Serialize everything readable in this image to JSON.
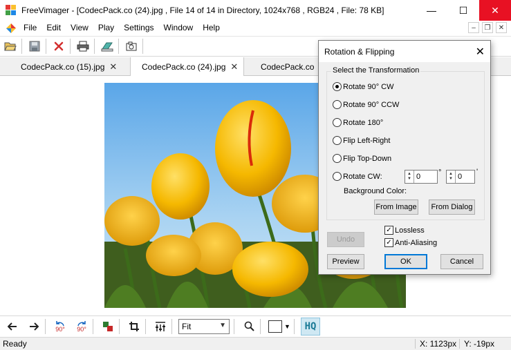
{
  "window": {
    "title": "FreeVimager - [CodecPack.co  (24).jpg , File 14 of 14 in Directory, 1024x768 , RGB24 , File: 78 KB]",
    "controls": {
      "minimize": "—",
      "maximize": "☐",
      "close": "✕"
    }
  },
  "menu": {
    "items": [
      "File",
      "Edit",
      "View",
      "Play",
      "Settings",
      "Window",
      "Help"
    ],
    "mdi": {
      "minimize": "–",
      "restore": "❐",
      "close": "✕"
    }
  },
  "toolbar": {
    "icons": [
      "open-folder-icon",
      "save-icon",
      "delete-icon",
      "print-icon",
      "scan-icon",
      "capture-icon"
    ]
  },
  "tabs": [
    {
      "label": "CodecPack.co  (15).jpg",
      "active": false
    },
    {
      "label": "CodecPack.co  (24).jpg",
      "active": true
    },
    {
      "label": "CodecPack.co",
      "active": false
    }
  ],
  "tab_close_glyph": "✕",
  "bottombar": {
    "zoom_value": "Fit",
    "hq_label": "HQ",
    "rotate_ccw_label": "90°",
    "rotate_cw_label": "90°"
  },
  "status": {
    "text": "Ready",
    "x": "X: 1123px",
    "y": "Y: -19px"
  },
  "dialog": {
    "title": "Rotation & Flipping",
    "group_label": "Select the Transformation",
    "options": [
      {
        "label": "Rotate 90° CW",
        "checked": true
      },
      {
        "label": "Rotate 90° CCW",
        "checked": false
      },
      {
        "label": "Rotate 180°",
        "checked": false
      },
      {
        "label": "Flip Left-Right",
        "checked": false
      },
      {
        "label": "Flip Top-Down",
        "checked": false
      },
      {
        "label": "Rotate CW:",
        "checked": false
      }
    ],
    "degrees_value": "0",
    "degrees_unit": "°",
    "minutes_value": "0",
    "minutes_unit": "'",
    "background_color_label": "Background Color:",
    "from_image_label": "From Image",
    "from_dialog_label": "From Dialog",
    "undo_label": "Undo",
    "lossless_label": "Lossless",
    "lossless_checked": true,
    "antialias_label": "Anti-Aliasing",
    "antialias_checked": true,
    "preview_label": "Preview",
    "ok_label": "OK",
    "cancel_label": "Cancel"
  }
}
